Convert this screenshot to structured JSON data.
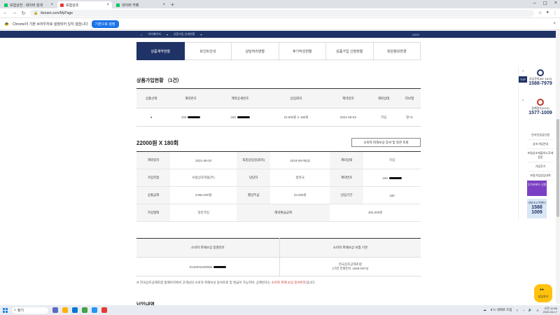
{
  "browser": {
    "tabs": [
      {
        "label": "보험상전 : 네이버 검색",
        "favicon_color": "#03c75a",
        "active": false
      },
      {
        "label": "보험상조",
        "favicon_color": "#e53935",
        "active": true
      },
      {
        "label": "네이버 카페",
        "favicon_color": "#03c75a",
        "active": false
      }
    ],
    "new_tab": "+",
    "address": "iboram.com/MyPage",
    "infobar_text": "Chrome이 기본 브라우저로 설정되어 있지 않습니다",
    "infobar_button": "기본으로 설정"
  },
  "site_bar": {
    "home": "마이페이지",
    "current": "상품가입 상세현황",
    "zoom": "100%"
  },
  "subtabs": [
    {
      "label": "상품계약현황",
      "active": true
    },
    {
      "label": "포인트안내",
      "active": false
    },
    {
      "label": "상담처리현황",
      "active": false
    },
    {
      "label": "후기작성현황",
      "active": false
    },
    {
      "label": "상품가입 신청현황",
      "active": false
    },
    {
      "label": "회원정보변경",
      "active": false
    }
  ],
  "contract_section": {
    "title": "상품가입현황 （1건）",
    "headers": [
      "상품선택",
      "계약번호",
      "계약상세번호",
      "납입회차",
      "계약일자",
      "계약상태",
      "피보험"
    ],
    "row": {
      "select": "●",
      "contract_no": "150",
      "detail_no": "150",
      "payment_round": "22,000원 X 180회",
      "contract_date": "2021-08-03",
      "status": "가입",
      "insured": "정*소"
    }
  },
  "product": {
    "title": "22000원 X 180회",
    "inquiry_button": "소비자 피해보상 증서 및 약관 조회"
  },
  "detail_table": {
    "rows": [
      [
        {
          "h": "계약일자"
        },
        {
          "v": "2021-08-03"
        },
        {
          "h": "최종납입일(회차)"
        },
        {
          "v": "2019-08-05(3)"
        },
        {
          "h": "계약상태"
        },
        {
          "v": "가입"
        }
      ],
      [
        {
          "h": "가입지점"
        },
        {
          "v": "보람상조피플(주)"
        },
        {
          "h": "담당자"
        },
        {
          "v": "정현국"
        },
        {
          "h": "계약번호"
        },
        {
          "v": "150"
        }
      ],
      [
        {
          "h": "상품금액"
        },
        {
          "v": "3,960,000원"
        },
        {
          "h": "월납부금"
        },
        {
          "v": "22,000원"
        },
        {
          "h": "납입기간"
        },
        {
          "v": "180"
        }
      ],
      [
        {
          "h": "가입형태"
        },
        {
          "v": "일반가입"
        },
        {
          "h": "해약환급금액"
        },
        {
          "v": "492,000원"
        }
      ]
    ]
  },
  "protection_table": {
    "headers": [
      "소비자 피해보상 증명번호",
      "소비자 피해보상 보험 기관"
    ],
    "certificate_no": "0140202100066",
    "agency_line1": "한국상조공제조합",
    "agency_line2": "(기관 전화번호 1668-0973)"
  },
  "note": {
    "prefix": "※ 한국상조공제조합 홈페이지에서 고객님의 소비자 피해보상 증서조회 및 발급이 가능하며, 공제번호는 ",
    "highlight": "소비자 피해 보상 증서번호",
    "suffix": "입니다."
  },
  "payment_section": {
    "title": "납입내역"
  },
  "quick_menu": {
    "counsel_label": "상담문의(09~18시)",
    "counsel_phone": "1588-7979",
    "emergency_label": "장례접수(24시)",
    "emergency_phone": "1577-1009",
    "links": [
      "온라인상담신청",
      "상조가입안내",
      "보람상조피플의노후대응문",
      "가입후기",
      "보람가입상담내역"
    ],
    "top": "TOP",
    "banner1": "무가서비스 신청",
    "banner2_label": "내보조고객센터",
    "banner2_phone1": "1588",
    "banner2_phone2": "1009"
  },
  "chat": {
    "label": "상담하기"
  },
  "taskbar": {
    "search": "찾기",
    "weather": "8°C 대체로 흐림",
    "ime": "A",
    "time": "오전 10:56",
    "date": "2020-03-17"
  }
}
